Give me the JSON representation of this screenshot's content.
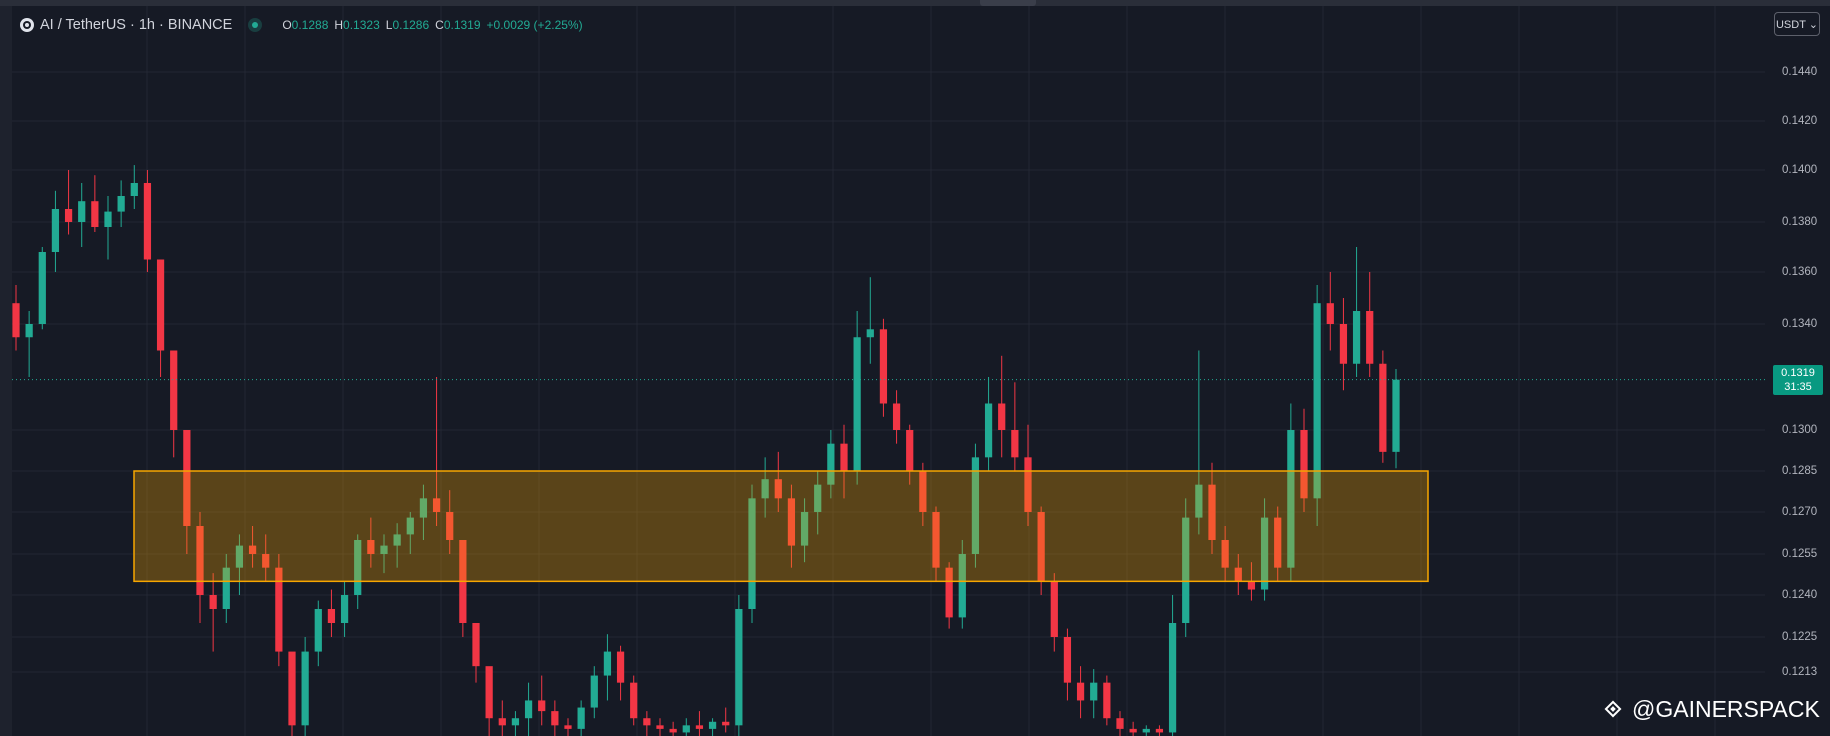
{
  "header": {
    "symbol": "AI / TetherUS · 1h · BINANCE",
    "open_label": "O",
    "open": "0.1288",
    "high_label": "H",
    "high": "0.1323",
    "low_label": "L",
    "low": "0.1286",
    "close_label": "C",
    "close": "0.1319",
    "change": "+0.0029 (+2.25%)"
  },
  "currency_button": "USDT ⌄",
  "last_price": {
    "value": "0.1319",
    "countdown": "31:35"
  },
  "watermark": {
    "at": "@",
    "text": "GAINERSPACK"
  },
  "colors": {
    "background": "#161a25",
    "up": "#22ab94",
    "down": "#f23645",
    "zone_fill": "#5a3d1e",
    "zone_border": "#f7a600"
  },
  "chart_data": {
    "type": "candlestick",
    "interval": "1h",
    "y_ticks": [
      "0.1440",
      "0.1420",
      "0.1400",
      "0.1380",
      "0.1360",
      "0.1340",
      "0.1300",
      "0.1285",
      "0.1270",
      "0.1255",
      "0.1240",
      "0.1225",
      "0.1213"
    ],
    "ylim": [
      0.1195,
      0.1455
    ],
    "zone": {
      "low": 0.1245,
      "high": 0.1285
    },
    "last_price": 0.1319,
    "grid": true,
    "candles_ohlc": [
      [
        0.1348,
        0.1355,
        0.133,
        0.1335
      ],
      [
        0.1335,
        0.1345,
        0.132,
        0.134
      ],
      [
        0.134,
        0.137,
        0.1338,
        0.1368
      ],
      [
        0.1368,
        0.1392,
        0.136,
        0.1385
      ],
      [
        0.1385,
        0.14,
        0.1375,
        0.138
      ],
      [
        0.138,
        0.1395,
        0.137,
        0.1388
      ],
      [
        0.1388,
        0.1398,
        0.1376,
        0.1378
      ],
      [
        0.1378,
        0.139,
        0.1365,
        0.1384
      ],
      [
        0.1384,
        0.1396,
        0.1378,
        0.139
      ],
      [
        0.139,
        0.1402,
        0.1385,
        0.1395
      ],
      [
        0.1395,
        0.14,
        0.136,
        0.1365
      ],
      [
        0.1365,
        0.135,
        0.132,
        0.133
      ],
      [
        0.133,
        0.1325,
        0.129,
        0.13
      ],
      [
        0.13,
        0.1295,
        0.1255,
        0.1265
      ],
      [
        0.1265,
        0.127,
        0.123,
        0.124
      ],
      [
        0.124,
        0.1248,
        0.122,
        0.1235
      ],
      [
        0.1235,
        0.1255,
        0.123,
        0.125
      ],
      [
        0.125,
        0.1262,
        0.124,
        0.1258
      ],
      [
        0.1258,
        0.1265,
        0.125,
        0.1255
      ],
      [
        0.1255,
        0.1262,
        0.1245,
        0.125
      ],
      [
        0.125,
        0.1255,
        0.1215,
        0.122
      ],
      [
        0.122,
        0.121,
        0.1195,
        0.1198
      ],
      [
        0.1198,
        0.1225,
        0.1195,
        0.122
      ],
      [
        0.122,
        0.1238,
        0.1215,
        0.1235
      ],
      [
        0.1235,
        0.1242,
        0.1225,
        0.123
      ],
      [
        0.123,
        0.1245,
        0.1225,
        0.124
      ],
      [
        0.124,
        0.1262,
        0.1235,
        0.126
      ],
      [
        0.126,
        0.1268,
        0.125,
        0.1255
      ],
      [
        0.1255,
        0.1262,
        0.1248,
        0.1258
      ],
      [
        0.1258,
        0.1266,
        0.125,
        0.1262
      ],
      [
        0.1262,
        0.127,
        0.1255,
        0.1268
      ],
      [
        0.1268,
        0.128,
        0.126,
        0.1275
      ],
      [
        0.1275,
        0.132,
        0.1265,
        0.127
      ],
      [
        0.127,
        0.1278,
        0.1255,
        0.126
      ],
      [
        0.126,
        0.1258,
        0.1225,
        0.123
      ],
      [
        0.123,
        0.1228,
        0.121,
        0.1215
      ],
      [
        0.1215,
        0.1212,
        0.1195,
        0.12
      ],
      [
        0.12,
        0.1205,
        0.1195,
        0.1198
      ],
      [
        0.1198,
        0.1202,
        0.1195,
        0.12
      ],
      [
        0.12,
        0.121,
        0.1195,
        0.1205
      ],
      [
        0.1205,
        0.1212,
        0.1198,
        0.1202
      ],
      [
        0.1202,
        0.1205,
        0.1195,
        0.1198
      ],
      [
        0.1198,
        0.12,
        0.1195,
        0.1197
      ],
      [
        0.1197,
        0.1205,
        0.1195,
        0.1203
      ],
      [
        0.1203,
        0.1215,
        0.12,
        0.1212
      ],
      [
        0.1212,
        0.1226,
        0.1205,
        0.122
      ],
      [
        0.122,
        0.1222,
        0.1205,
        0.121
      ],
      [
        0.121,
        0.1212,
        0.1198,
        0.12
      ],
      [
        0.12,
        0.1202,
        0.1195,
        0.1198
      ],
      [
        0.1198,
        0.12,
        0.1195,
        0.1197
      ],
      [
        0.1197,
        0.1199,
        0.1195,
        0.1196
      ],
      [
        0.1196,
        0.12,
        0.1195,
        0.1198
      ],
      [
        0.1198,
        0.1202,
        0.1195,
        0.1197
      ],
      [
        0.1197,
        0.12,
        0.1195,
        0.1199
      ],
      [
        0.1199,
        0.1203,
        0.1196,
        0.1198
      ],
      [
        0.1198,
        0.124,
        0.1195,
        0.1235
      ],
      [
        0.1235,
        0.128,
        0.123,
        0.1275
      ],
      [
        0.1275,
        0.129,
        0.1268,
        0.1282
      ],
      [
        0.1282,
        0.1292,
        0.127,
        0.1275
      ],
      [
        0.1275,
        0.128,
        0.125,
        0.1258
      ],
      [
        0.1258,
        0.1275,
        0.1252,
        0.127
      ],
      [
        0.127,
        0.1285,
        0.1262,
        0.128
      ],
      [
        0.128,
        0.13,
        0.1275,
        0.1295
      ],
      [
        0.1295,
        0.1302,
        0.1275,
        0.1285
      ],
      [
        0.1285,
        0.1345,
        0.128,
        0.1335
      ],
      [
        0.1335,
        0.1358,
        0.1325,
        0.1338
      ],
      [
        0.1338,
        0.1342,
        0.1305,
        0.131
      ],
      [
        0.131,
        0.1315,
        0.1295,
        0.13
      ],
      [
        0.13,
        0.1302,
        0.128,
        0.1285
      ],
      [
        0.1285,
        0.1288,
        0.1265,
        0.127
      ],
      [
        0.127,
        0.1272,
        0.1245,
        0.125
      ],
      [
        0.125,
        0.1252,
        0.1228,
        0.1232
      ],
      [
        0.1232,
        0.126,
        0.1228,
        0.1255
      ],
      [
        0.1255,
        0.1295,
        0.125,
        0.129
      ],
      [
        0.129,
        0.132,
        0.1285,
        0.131
      ],
      [
        0.131,
        0.1328,
        0.129,
        0.13
      ],
      [
        0.13,
        0.1318,
        0.1285,
        0.129
      ],
      [
        0.129,
        0.1302,
        0.1265,
        0.127
      ],
      [
        0.127,
        0.1272,
        0.124,
        0.1245
      ],
      [
        0.1245,
        0.1248,
        0.122,
        0.1225
      ],
      [
        0.1225,
        0.1228,
        0.1205,
        0.121
      ],
      [
        0.121,
        0.1215,
        0.12,
        0.1205
      ],
      [
        0.1205,
        0.1214,
        0.12,
        0.121
      ],
      [
        0.121,
        0.1212,
        0.1198,
        0.12
      ],
      [
        0.12,
        0.1202,
        0.1195,
        0.1197
      ],
      [
        0.1197,
        0.1199,
        0.1195,
        0.1196
      ],
      [
        0.1196,
        0.1198,
        0.1195,
        0.1197
      ],
      [
        0.1197,
        0.1198,
        0.1195,
        0.1196
      ],
      [
        0.1196,
        0.124,
        0.1195,
        0.123
      ],
      [
        0.123,
        0.1275,
        0.1225,
        0.1268
      ],
      [
        0.1268,
        0.133,
        0.1262,
        0.128
      ],
      [
        0.128,
        0.1288,
        0.1255,
        0.126
      ],
      [
        0.126,
        0.1265,
        0.1245,
        0.125
      ],
      [
        0.125,
        0.1255,
        0.124,
        0.1245
      ],
      [
        0.1245,
        0.1252,
        0.1238,
        0.1242
      ],
      [
        0.1242,
        0.1275,
        0.1238,
        0.1268
      ],
      [
        0.1268,
        0.1272,
        0.1245,
        0.125
      ],
      [
        0.125,
        0.131,
        0.1245,
        0.13
      ],
      [
        0.13,
        0.1308,
        0.127,
        0.1275
      ],
      [
        0.1275,
        0.1355,
        0.1265,
        0.1348
      ],
      [
        0.1348,
        0.136,
        0.133,
        0.134
      ],
      [
        0.134,
        0.135,
        0.1315,
        0.1325
      ],
      [
        0.1325,
        0.137,
        0.132,
        0.1345
      ],
      [
        0.1345,
        0.136,
        0.132,
        0.1325
      ],
      [
        0.1325,
        0.133,
        0.1288,
        0.1292
      ],
      [
        0.1292,
        0.1323,
        0.1286,
        0.1319
      ]
    ]
  }
}
